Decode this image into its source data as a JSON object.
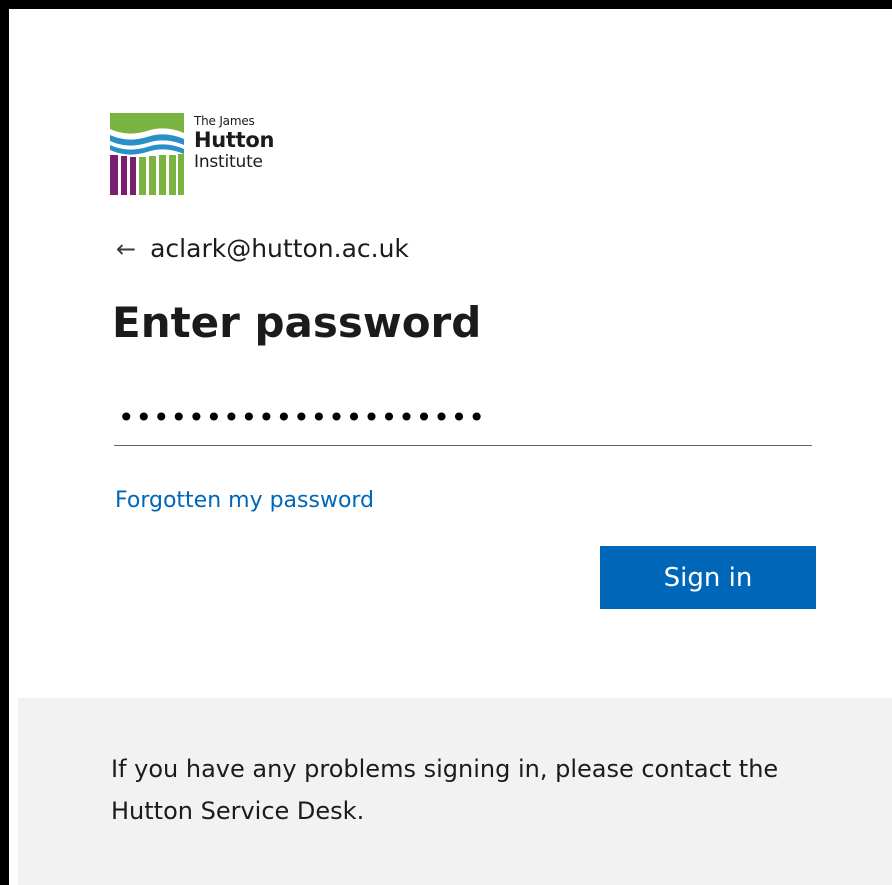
{
  "logo": {
    "line1": "The James",
    "line2": "Hutton",
    "line3": "Institute",
    "colors": {
      "green": "#7ab340",
      "blue": "#2a8fc9",
      "purple": "#7a1d6e"
    }
  },
  "identity": {
    "back_icon": "back-arrow-icon",
    "email": "aclark@hutton.ac.uk"
  },
  "title": "Enter password",
  "password": {
    "masked_value": "•••••••••••••••••••••"
  },
  "forgot_link": "Forgotten my password",
  "signin_button": "Sign in",
  "footer": {
    "message": "If you have any problems signing in, please contact the Hutton Service Desk."
  },
  "colors": {
    "accent": "#0067b8",
    "footer_bg": "#f2f2f2"
  }
}
